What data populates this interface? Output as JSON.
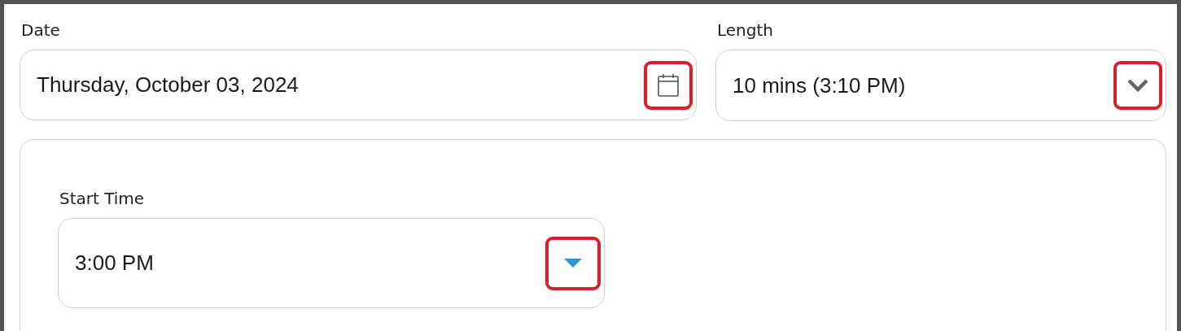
{
  "fields": [
    {
      "label": "Date",
      "value": "Thursday, October 03, 2024",
      "kind": "date",
      "icon_highlighted": true
    },
    {
      "label": "Length",
      "value": "10 mins (3:10 PM)",
      "kind": "select",
      "icon_highlighted": true
    }
  ],
  "panel": {
    "fields": [
      {
        "label": "Start Time",
        "value": "3:00 PM",
        "kind": "time",
        "icon_highlighted": true
      }
    ]
  }
}
